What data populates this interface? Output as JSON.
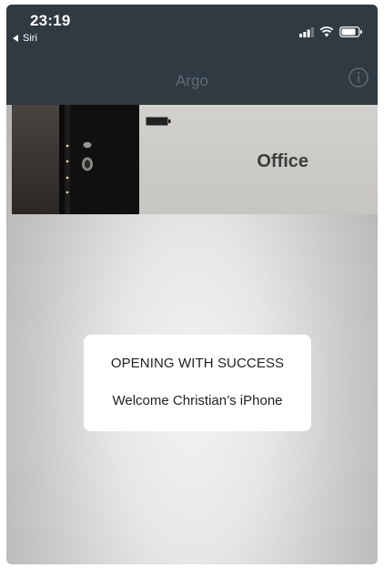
{
  "status_bar": {
    "time": "23:19",
    "back_app": "Siri"
  },
  "navbar": {
    "title": "Argo"
  },
  "doors": [
    {
      "name": "Office"
    }
  ],
  "toast": {
    "title": "OPENING WITH SUCCESS",
    "message": "Welcome Christian’s iPhone"
  },
  "icons": [
    "back-arrow-icon",
    "signal-icon",
    "wifi-icon",
    "battery-icon",
    "info-icon",
    "door-battery-icon"
  ],
  "colors": {
    "bar_background": "#2f3a43",
    "title_color": "#5f6b75"
  }
}
